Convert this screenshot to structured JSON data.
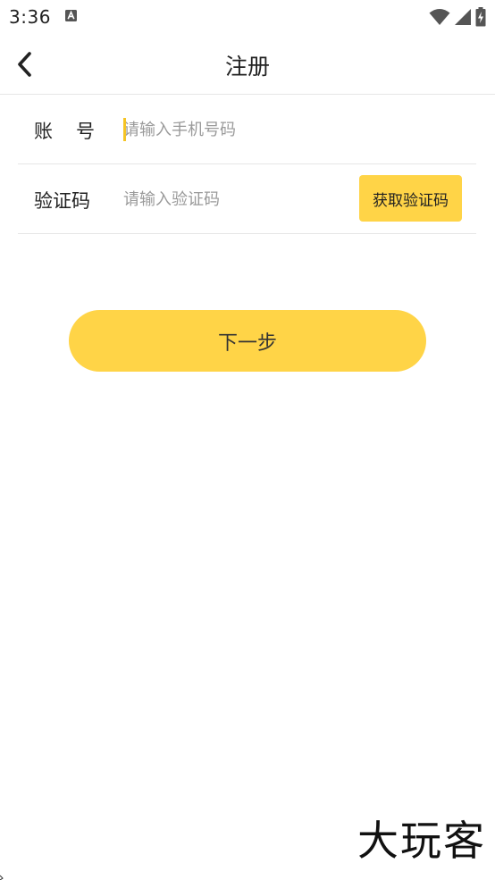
{
  "status_bar": {
    "time": "3:36",
    "notification_icon": "a-badge-icon",
    "wifi_icon": "wifi-icon",
    "signal_icon": "cell-signal-icon",
    "battery_icon": "battery-charging-icon"
  },
  "header": {
    "back_icon": "chevron-left-icon",
    "title": "注册"
  },
  "form": {
    "account": {
      "label": "账号",
      "placeholder": "请输入手机号码",
      "value": ""
    },
    "code": {
      "label": "验证码",
      "placeholder": "请输入验证码",
      "value": "",
      "get_code_label": "获取验证码"
    }
  },
  "next_button_label": "下一步",
  "watermark": "大玩客",
  "colors": {
    "accent": "#ffd447",
    "caret": "#f5c425",
    "divider": "#e6e6e6",
    "placeholder": "#9a9a9a",
    "text": "#222222"
  }
}
